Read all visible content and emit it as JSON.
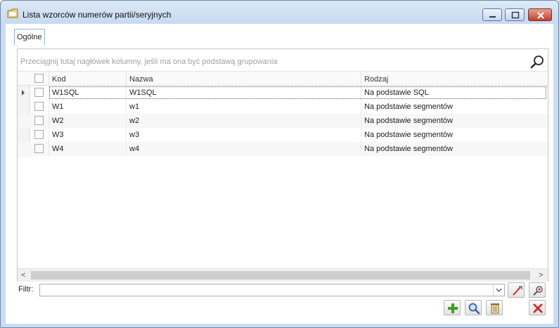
{
  "window": {
    "title": "Lista wzorców numerów partii/seryjnych"
  },
  "tabs": [
    {
      "label": "Ogólne"
    }
  ],
  "grid": {
    "group_hint": "Przeciągnij tutaj nagłówek kolumny, jeśli ma ona być podstawą grupowania",
    "columns": [
      {
        "label": "Kod"
      },
      {
        "label": "Nazwa"
      },
      {
        "label": "Rodzaj"
      }
    ],
    "rows": [
      {
        "kod": "W1SQL",
        "nazwa": "W1SQL",
        "rodzaj": "Na podstawie SQL",
        "selected": true
      },
      {
        "kod": "W1",
        "nazwa": "w1",
        "rodzaj": "Na podstawie segmentów"
      },
      {
        "kod": "W2",
        "nazwa": "w2",
        "rodzaj": "Na podstawie segmentów"
      },
      {
        "kod": "W3",
        "nazwa": "w3",
        "rodzaj": "Na podstawie segmentów"
      },
      {
        "kod": "W4",
        "nazwa": "w4",
        "rodzaj": "Na podstawie segmentów"
      }
    ]
  },
  "filter": {
    "label": "Filtr:",
    "value": ""
  },
  "icons": {
    "window": "folder-icon",
    "search": "search-icon",
    "clear_filter": "clear-filter-icon",
    "filter_settings": "filter-settings-icon",
    "add": "add-icon",
    "view": "magnifier-icon",
    "delete": "trash-icon",
    "close": "close-icon"
  },
  "colors": {
    "titlebar": "#c7daf0",
    "close_button": "#c2432a",
    "add": "#3aa21a",
    "close": "#d82020",
    "accent": "#8db2e3"
  }
}
